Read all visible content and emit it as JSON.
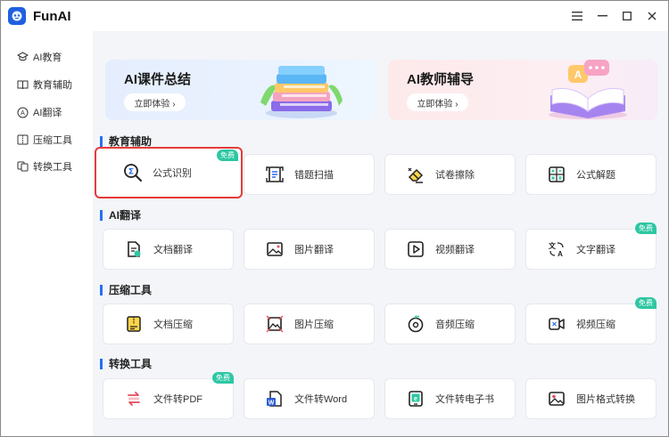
{
  "app": {
    "name": "FunAI"
  },
  "sidebar": {
    "items": [
      {
        "label": "AI教育",
        "icon": "graduation-cap-icon"
      },
      {
        "label": "教育辅助",
        "icon": "book-icon"
      },
      {
        "label": "AI翻译",
        "icon": "translate-icon"
      },
      {
        "label": "压缩工具",
        "icon": "compress-icon"
      },
      {
        "label": "转换工具",
        "icon": "convert-icon"
      }
    ]
  },
  "banners": [
    {
      "title": "AI课件总结",
      "button": "立即体验 ›"
    },
    {
      "title": "AI教师辅导",
      "button": "立即体验 ›"
    }
  ],
  "sections": [
    {
      "title": "教育辅助",
      "cards": [
        {
          "label": "公式识别",
          "badge": "免费",
          "icon": "formula-search-icon"
        },
        {
          "label": "错题扫描",
          "icon": "scan-icon"
        },
        {
          "label": "试卷擦除",
          "icon": "eraser-icon"
        },
        {
          "label": "公式解题",
          "icon": "calculator-icon"
        }
      ]
    },
    {
      "title": "AI翻译",
      "cards": [
        {
          "label": "文档翻译",
          "icon": "doc-translate-icon"
        },
        {
          "label": "图片翻译",
          "icon": "image-translate-icon"
        },
        {
          "label": "视频翻译",
          "icon": "video-play-icon"
        },
        {
          "label": "文字翻译",
          "badge": "免费",
          "icon": "text-translate-icon"
        }
      ]
    },
    {
      "title": "压缩工具",
      "cards": [
        {
          "label": "文档压缩",
          "icon": "doc-compress-icon"
        },
        {
          "label": "图片压缩",
          "icon": "image-compress-icon"
        },
        {
          "label": "音频压缩",
          "icon": "audio-compress-icon"
        },
        {
          "label": "视频压缩",
          "badge": "免费",
          "icon": "video-compress-icon"
        }
      ]
    },
    {
      "title": "转换工具",
      "cards": [
        {
          "label": "文件转PDF",
          "badge": "免费",
          "icon": "pdf-convert-icon"
        },
        {
          "label": "文件转Word",
          "icon": "word-icon"
        },
        {
          "label": "文件转电子书",
          "icon": "ebook-icon"
        },
        {
          "label": "图片格式转换",
          "icon": "image-format-icon"
        }
      ]
    }
  ],
  "colors": {
    "accent": "#2a6ff3",
    "badge": "#2ec7a3",
    "highlight": "#e83a3a"
  }
}
